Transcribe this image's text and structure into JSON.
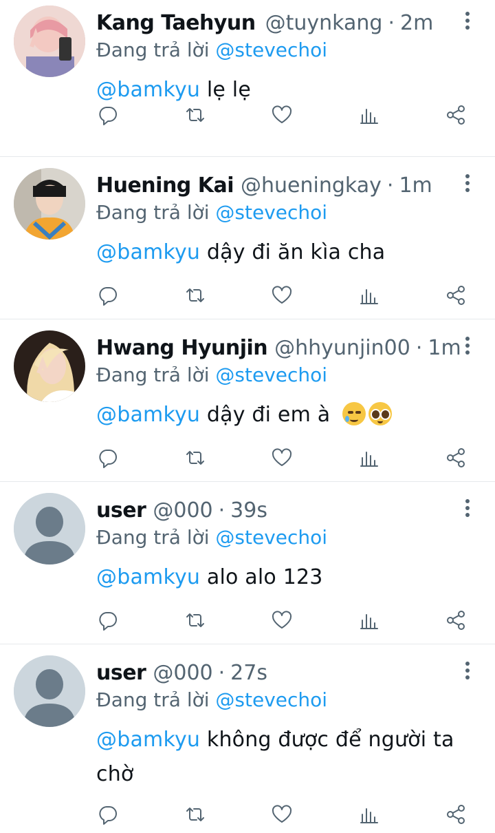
{
  "replying_label": "Đang trả lời",
  "tweets": [
    {
      "name": "Kang Taehyun",
      "handle": "@tuynkang",
      "time": "2m",
      "reply_to": "@stevechoi",
      "mention": "@bamkyu",
      "text": "lẹ lẹ"
    },
    {
      "name": "Huening Kai",
      "handle": "@hueningkay",
      "time": "1m",
      "reply_to": "@stevechoi",
      "mention": "@bamkyu",
      "text": "dậy đi ăn kìa cha"
    },
    {
      "name": "Hwang Hyunjin",
      "handle": "@hhyunjin00",
      "time": "1m",
      "reply_to": "@stevechoi",
      "mention": "@bamkyu",
      "text": "dậy đi em à",
      "emojis": [
        "face-holding-back-tears",
        "pleading-face"
      ]
    },
    {
      "name": "user",
      "handle": "@000",
      "time": "39s",
      "reply_to": "@stevechoi",
      "mention": "@bamkyu",
      "text": "alo alo 123"
    },
    {
      "name": "user",
      "handle": "@000",
      "time": "27s",
      "reply_to": "@stevechoi",
      "mention": "@bamkyu",
      "text": "không được để người ta chờ"
    }
  ],
  "separator": "·",
  "icons": [
    "reply-icon",
    "retweet-icon",
    "like-icon",
    "analytics-icon",
    "share-icon",
    "more-icon"
  ],
  "colors": {
    "link": "#1d9bf0",
    "secondary": "#536471",
    "text": "#0f1419",
    "avatar_placeholder": "#ccd6dd"
  }
}
